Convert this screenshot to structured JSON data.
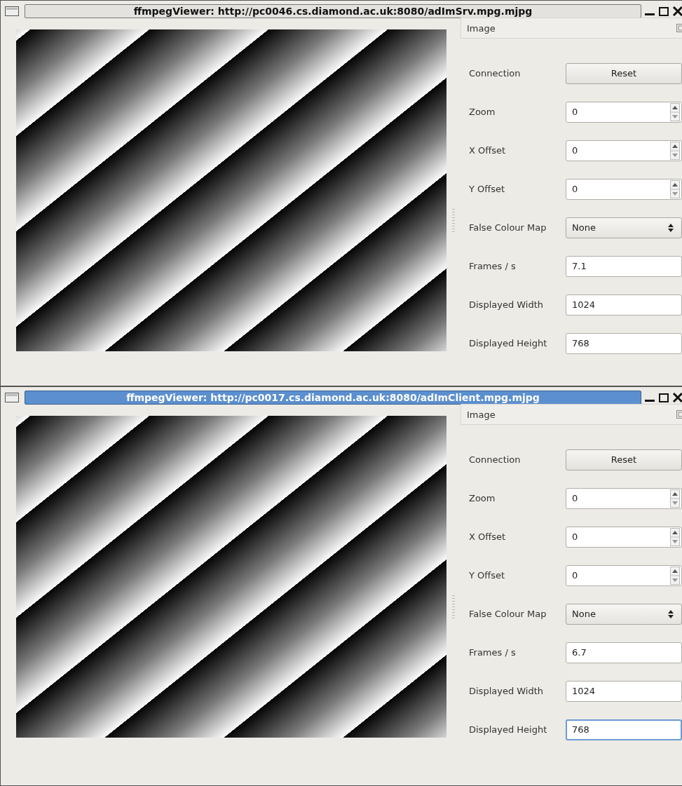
{
  "windows": [
    {
      "title": "ffmpegViewer: http://pc0046.cs.diamond.ac.uk:8080/adImSrv.mpg.mjpg",
      "active": false,
      "panel": {
        "title": "Image",
        "rows": [
          {
            "kind": "button",
            "label": "Connection",
            "value": "Reset",
            "focused": false
          },
          {
            "kind": "spinbox",
            "label": "Zoom",
            "value": "0",
            "focused": false
          },
          {
            "kind": "spinbox",
            "label": "X Offset",
            "value": "0",
            "focused": false
          },
          {
            "kind": "spinbox",
            "label": "Y Offset",
            "value": "0",
            "focused": false
          },
          {
            "kind": "combo",
            "label": "False Colour Map",
            "value": "None",
            "focused": false
          },
          {
            "kind": "text",
            "label": "Frames / s",
            "value": "7.1",
            "focused": false
          },
          {
            "kind": "text",
            "label": "Displayed Width",
            "value": "1024",
            "focused": false
          },
          {
            "kind": "text",
            "label": "Displayed Height",
            "value": "768",
            "focused": false
          }
        ]
      }
    },
    {
      "title": "ffmpegViewer: http://pc0017.cs.diamond.ac.uk:8080/adImClient.mpg.mjpg",
      "active": true,
      "panel": {
        "title": "Image",
        "rows": [
          {
            "kind": "button",
            "label": "Connection",
            "value": "Reset",
            "focused": false
          },
          {
            "kind": "spinbox",
            "label": "Zoom",
            "value": "0",
            "focused": false
          },
          {
            "kind": "spinbox",
            "label": "X Offset",
            "value": "0",
            "focused": false
          },
          {
            "kind": "spinbox",
            "label": "Y Offset",
            "value": "0",
            "focused": false
          },
          {
            "kind": "combo",
            "label": "False Colour Map",
            "value": "None",
            "focused": false
          },
          {
            "kind": "text",
            "label": "Frames / s",
            "value": "6.7",
            "focused": false
          },
          {
            "kind": "text",
            "label": "Displayed Width",
            "value": "1024",
            "focused": false
          },
          {
            "kind": "text",
            "label": "Displayed Height",
            "value": "768",
            "focused": true
          }
        ]
      }
    }
  ]
}
